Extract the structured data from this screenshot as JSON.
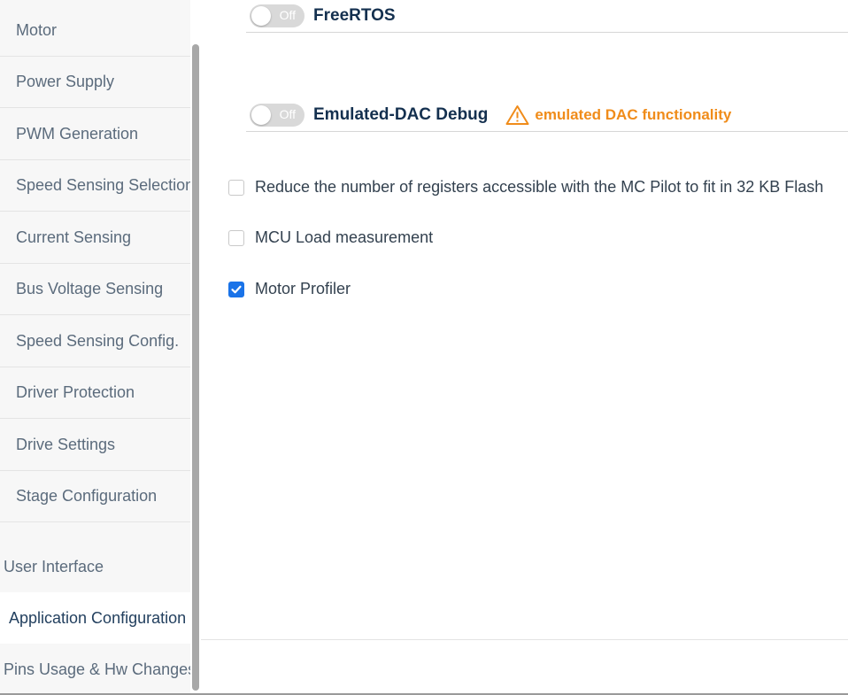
{
  "sidebar": {
    "items": [
      {
        "label": "Motor"
      },
      {
        "label": "Power Supply"
      },
      {
        "label": "PWM Generation"
      },
      {
        "label": "Speed Sensing Selection"
      },
      {
        "label": "Current Sensing"
      },
      {
        "label": "Bus Voltage Sensing"
      },
      {
        "label": "Speed Sensing Config."
      },
      {
        "label": "Driver Protection"
      },
      {
        "label": "Drive Settings"
      },
      {
        "label": "Stage Configuration"
      }
    ],
    "sections": [
      {
        "label": "User Interface",
        "active": false
      },
      {
        "label": "Application Configuration",
        "active": true
      },
      {
        "label": "Pins Usage & Hw Changes",
        "active": false
      }
    ]
  },
  "main": {
    "features": [
      {
        "title": "FreeRTOS",
        "toggle_state": "Off"
      },
      {
        "title": "Emulated-DAC Debug",
        "toggle_state": "Off",
        "warning": "emulated DAC functionality"
      }
    ],
    "options": [
      {
        "label": "Reduce the number of registers accessible with the MC Pilot to fit in 32 KB Flash",
        "checked": false
      },
      {
        "label": "MCU Load measurement",
        "checked": false
      },
      {
        "label": "Motor Profiler",
        "checked": true
      }
    ]
  },
  "colors": {
    "accent": "#1a73e8",
    "warning": "#f08c1a",
    "title": "#14304f"
  },
  "icons": [
    "warning-icon",
    "checkmark-icon"
  ]
}
